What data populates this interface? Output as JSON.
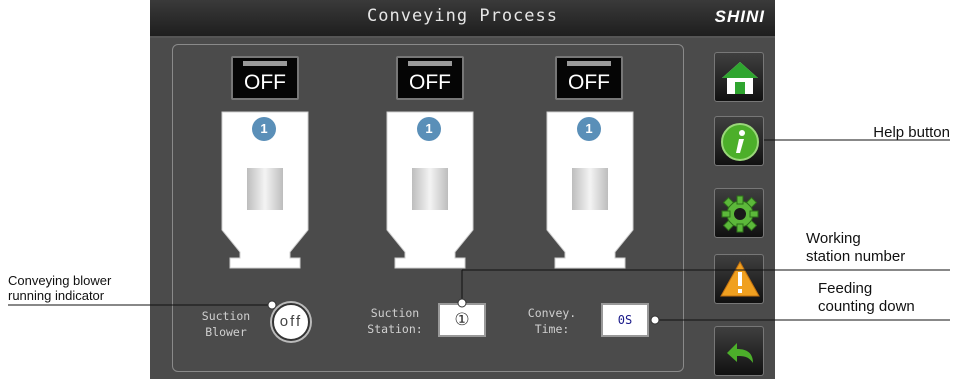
{
  "header": {
    "title": "Conveying Process",
    "logo": "SHINI"
  },
  "stations": [
    {
      "button_label": "OFF",
      "badge": "1"
    },
    {
      "button_label": "OFF",
      "badge": "1"
    },
    {
      "button_label": "OFF",
      "badge": "1"
    }
  ],
  "bottom": {
    "blower_label_1": "Suction",
    "blower_label_2": "Blower",
    "blower_status": "off",
    "station_label_1": "Suction",
    "station_label_2": "Station:",
    "station_value": "①",
    "time_label_1": "Convey.",
    "time_label_2": "Time:",
    "time_value": "0S"
  },
  "sidebar": [
    {
      "icon": "home-icon"
    },
    {
      "icon": "info-icon"
    },
    {
      "icon": "gear-icon"
    },
    {
      "icon": "warning-icon"
    },
    {
      "icon": "back-arrow-icon"
    }
  ],
  "callouts": {
    "help_button": "Help button",
    "working_station_1": "Working",
    "working_station_2": "station number",
    "feeding_1": "Feeding",
    "feeding_2": "counting down",
    "blower_1": "Conveying blower",
    "blower_2": "running indicator"
  },
  "colors": {
    "badge": "#5a8fb8",
    "screen_bg": "#4b4b4b",
    "time_text": "#1a1a8a"
  }
}
